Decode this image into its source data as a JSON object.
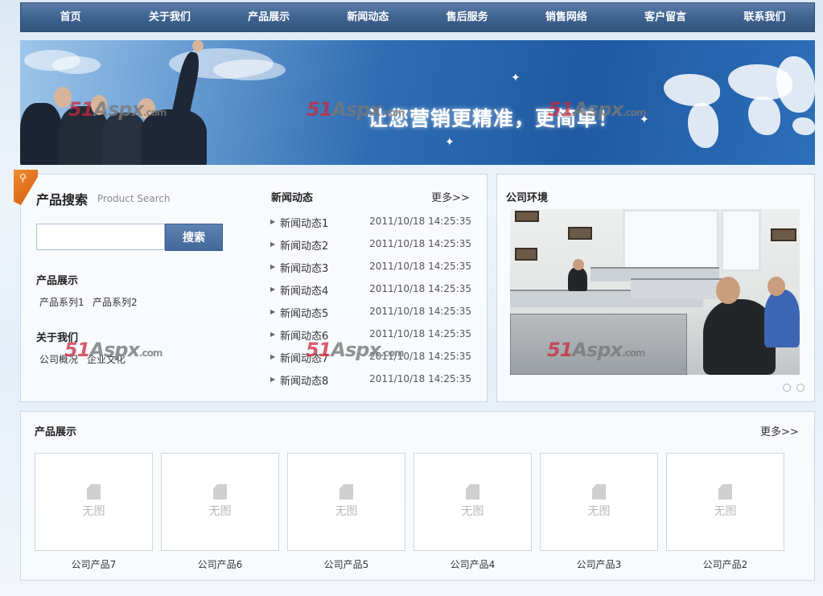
{
  "nav": {
    "items": [
      {
        "label": "首页"
      },
      {
        "label": "关于我们"
      },
      {
        "label": "产品展示"
      },
      {
        "label": "新闻动态"
      },
      {
        "label": "售后服务"
      },
      {
        "label": "销售网络"
      },
      {
        "label": "客户留言"
      },
      {
        "label": "联系我们"
      }
    ]
  },
  "banner": {
    "slogan": "让您营销更精准，更简单！",
    "watermark": {
      "brand": "51",
      "word": "Aspx",
      "suffix": ".com"
    }
  },
  "search": {
    "title": "产品搜索",
    "subtitle": "Product Search",
    "input_value": "",
    "button_label": "搜索"
  },
  "product_nav": {
    "title": "产品展示",
    "items": [
      "产品系列1",
      "产品系列2"
    ]
  },
  "about_nav": {
    "title": "关于我们",
    "items": [
      "公司概况",
      "企业文化"
    ]
  },
  "news": {
    "title": "新闻动态",
    "more_label": "更多>>",
    "items": [
      {
        "title": "新闻动态1",
        "date": "2011/10/18 14:25:35"
      },
      {
        "title": "新闻动态2",
        "date": "2011/10/18 14:25:35"
      },
      {
        "title": "新闻动态3",
        "date": "2011/10/18 14:25:35"
      },
      {
        "title": "新闻动态4",
        "date": "2011/10/18 14:25:35"
      },
      {
        "title": "新闻动态5",
        "date": "2011/10/18 14:25:35"
      },
      {
        "title": "新闻动态6",
        "date": "2011/10/18 14:25:35"
      },
      {
        "title": "新闻动态7",
        "date": "2011/10/18 14:25:35"
      },
      {
        "title": "新闻动态8",
        "date": "2011/10/18 14:25:35"
      }
    ]
  },
  "environment": {
    "title": "公司环境"
  },
  "products": {
    "title": "产品展示",
    "more_label": "更多>>",
    "placeholder_text": "无图",
    "items": [
      {
        "name": "公司产品7"
      },
      {
        "name": "公司产品6"
      },
      {
        "name": "公司产品5"
      },
      {
        "name": "公司产品4"
      },
      {
        "name": "公司产品3"
      },
      {
        "name": "公司产品2"
      }
    ]
  },
  "colors": {
    "nav_bg": "#3f6390",
    "accent_orange": "#f08a2c",
    "button_blue": "#4f74a4"
  }
}
